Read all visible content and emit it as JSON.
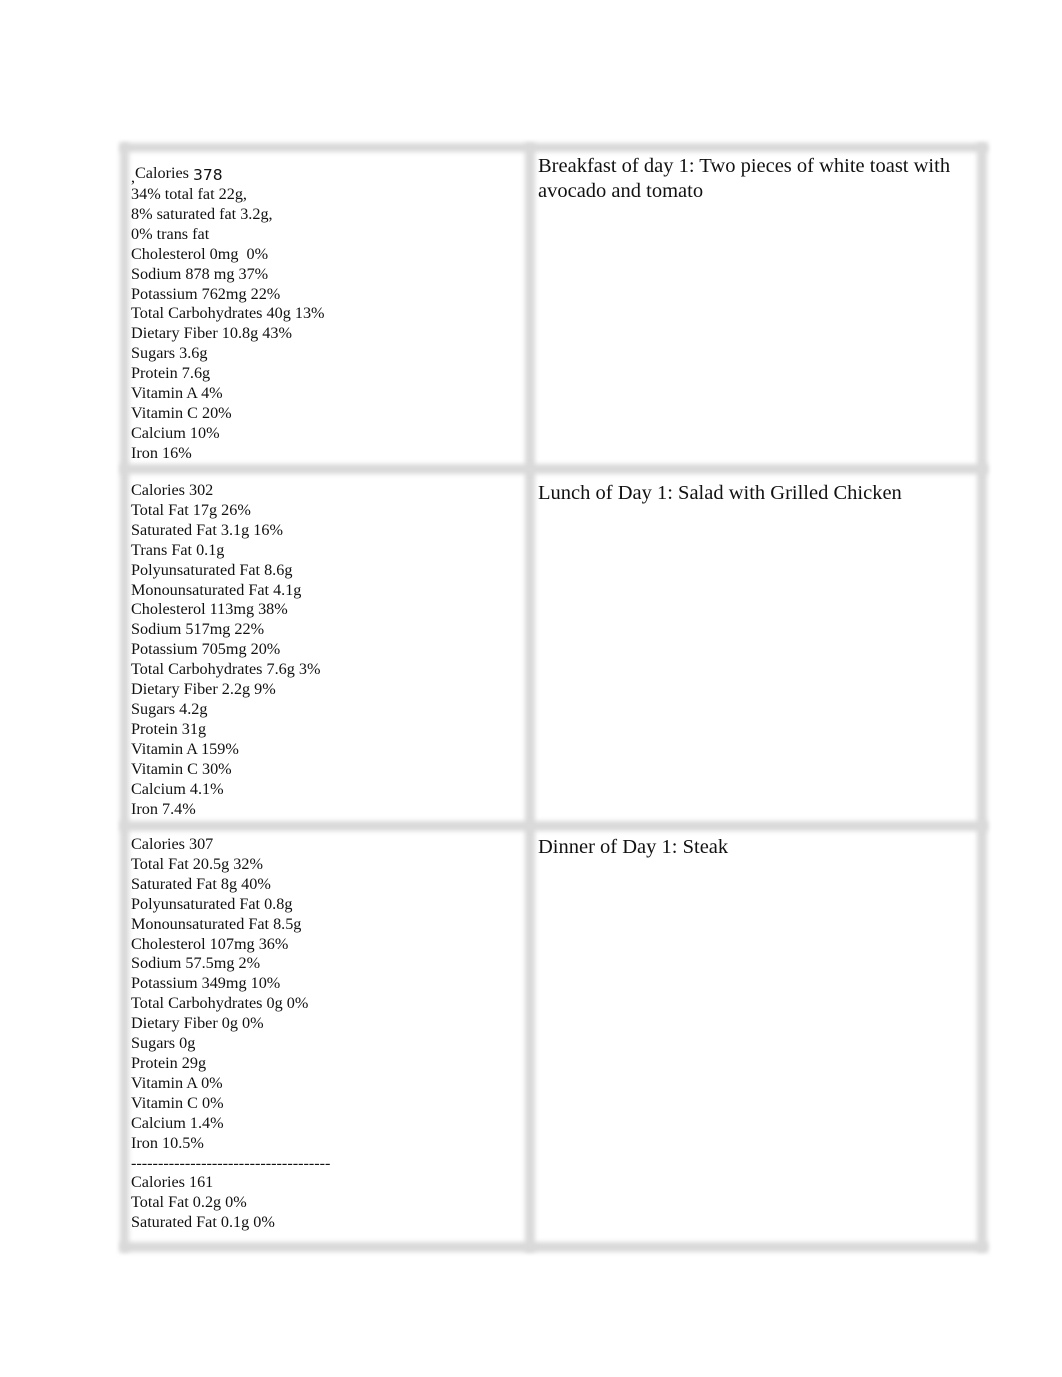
{
  "document": {
    "rows": [
      {
        "meal_title": "Breakfast of day 1: Two pieces of white toast with avocado and tomato",
        "first_line": {
          "prefix_mark": ",",
          "label": "Calories",
          "value": "378"
        },
        "nutrition": [
          "34% total fat 22g,",
          "8% saturated fat 3.2g,",
          "0% trans fat",
          "Cholesterol 0mg  0%",
          "Sodium 878 mg 37%",
          "Potassium 762mg 22%",
          "Total Carbohydrates 40g 13%",
          "Dietary Fiber 10.8g 43%",
          "Sugars 3.6g",
          "Protein 7.6g",
          "Vitamin A 4%",
          "Vitamin C 20%",
          "Calcium 10%",
          "Iron 16%"
        ]
      },
      {
        "meal_title": "Lunch of Day 1: Salad with Grilled Chicken",
        "nutrition": [
          "Calories 302",
          "Total Fat 17g 26%",
          "Saturated Fat 3.1g 16%",
          "Trans Fat 0.1g",
          "Polyunsaturated Fat 8.6g",
          "Monounsaturated Fat 4.1g",
          "Cholesterol 113mg 38%",
          "Sodium 517mg 22%",
          "Potassium 705mg 20%",
          "Total Carbohydrates 7.6g 3%",
          "Dietary Fiber 2.2g 9%",
          "Sugars 4.2g",
          "Protein 31g",
          "Vitamin A 159%",
          "Vitamin C 30%",
          "Calcium 4.1%",
          "Iron 7.4%"
        ]
      },
      {
        "meal_title": "Dinner of Day 1: Steak",
        "nutrition": [
          "Calories 307",
          "Total Fat 20.5g 32%",
          "Saturated Fat 8g 40%",
          "Polyunsaturated Fat 0.8g",
          "Monounsaturated Fat 8.5g",
          "Cholesterol 107mg 36%",
          "Sodium 57.5mg 2%",
          "Potassium 349mg 10%",
          "Total Carbohydrates 0g 0%",
          "Dietary Fiber 0g 0%",
          "Sugars 0g",
          "Protein 29g",
          "Vitamin A 0%",
          "Vitamin C 0%",
          "Calcium 1.4%",
          "Iron 10.5%",
          "-------------------------------------",
          "Calories 161",
          "Total Fat 0.2g 0%",
          "Saturated Fat 0.1g 0%"
        ]
      }
    ]
  }
}
